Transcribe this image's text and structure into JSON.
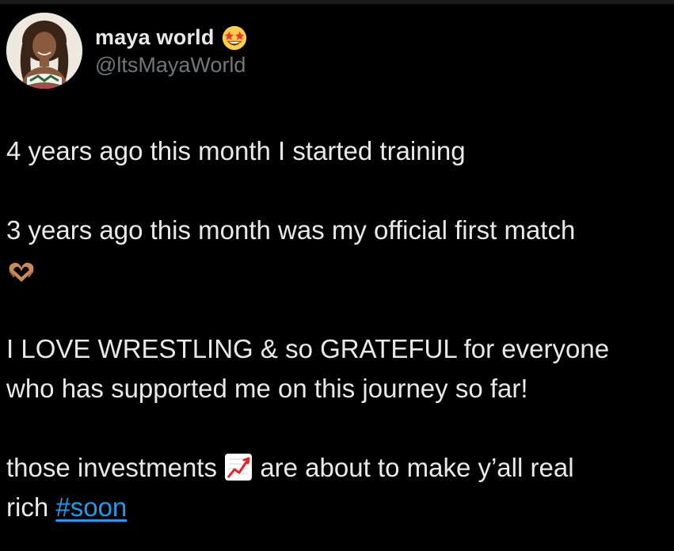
{
  "author": {
    "display_name": "maya world",
    "name_emoji": "star-struck-emoji-icon",
    "handle": "@ltsMayaWorld"
  },
  "tweet": {
    "line1": "4 years ago this month I started training",
    "line2": "3 years ago this month was my official first match",
    "line2_emoji": "heart-hands-emoji-icon",
    "line3a": "I LOVE WRESTLING & so GRATEFUL for everyone",
    "line3b": "who has supported me on this journey so far!",
    "line4a_before": "those investments",
    "line4a_emoji": "chart-increasing-emoji-icon",
    "line4a_after": "are about to make y’all real",
    "line4b_before": "rich",
    "hashtag": "#soon"
  },
  "colors": {
    "background": "#000000",
    "text": "#e7e9ea",
    "secondary_text": "#71767b",
    "link": "#1d9bf0"
  }
}
